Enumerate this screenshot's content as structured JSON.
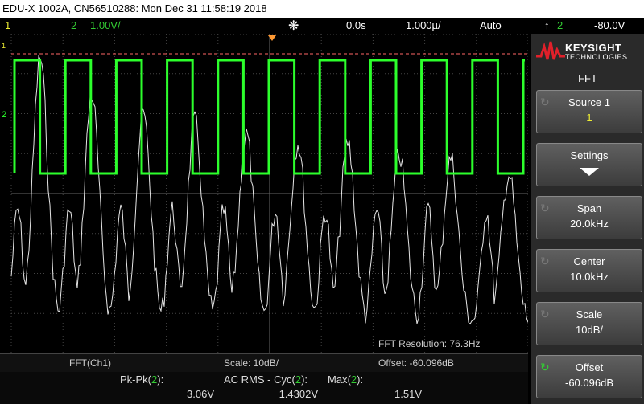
{
  "window": {
    "title": "EDU-X 1002A, CN56510288: Mon Dec 31 11:58:19 2018"
  },
  "status_bar": {
    "ch1_label": "1",
    "ch2_label": "2",
    "ch2_scale": "1.00V/",
    "run_icon": "trigger-settings-icon",
    "time_delay": "0.0s",
    "time_base": "1.000µ/",
    "trigger_mode": "Auto",
    "trigger_slope_icon": "rising-edge-icon",
    "trigger_channel": "2",
    "trigger_level": "-80.0V"
  },
  "screen": {
    "ch1_marker": "1",
    "ch2_marker": "2",
    "fft_resolution": "FFT Resolution: 76.3Hz",
    "colors": {
      "ch1": "#e8e844",
      "ch2": "#2cff2c",
      "fft": "#e6e6e6",
      "grid": "#444444",
      "trigger_line": "#ff6666"
    }
  },
  "brand": {
    "name": "KEYSIGHT",
    "subtitle": "TECHNOLOGIES"
  },
  "menu": {
    "title": "FFT",
    "softkeys": [
      {
        "label": "Source 1",
        "value": "1"
      },
      {
        "label": "Settings",
        "value": ""
      },
      {
        "label": "Span",
        "value": "20.0kHz"
      },
      {
        "label": "Center",
        "value": "10.0kHz"
      },
      {
        "label": "Scale",
        "value": "10dB/"
      },
      {
        "label": "Offset",
        "value": "-60.096dB"
      }
    ]
  },
  "info_bar": {
    "source": "FFT(Ch1)",
    "scale": "Scale: 10dB/",
    "offset": "Offset: -60.096dB"
  },
  "measurements": [
    {
      "label": "Pk-Pk",
      "channel": "2",
      "value": "3.06V"
    },
    {
      "label": "AC RMS - Cyc",
      "channel": "2",
      "value": "1.4302V"
    },
    {
      "label": "Max",
      "channel": "2",
      "value": "1.51V"
    }
  ]
}
